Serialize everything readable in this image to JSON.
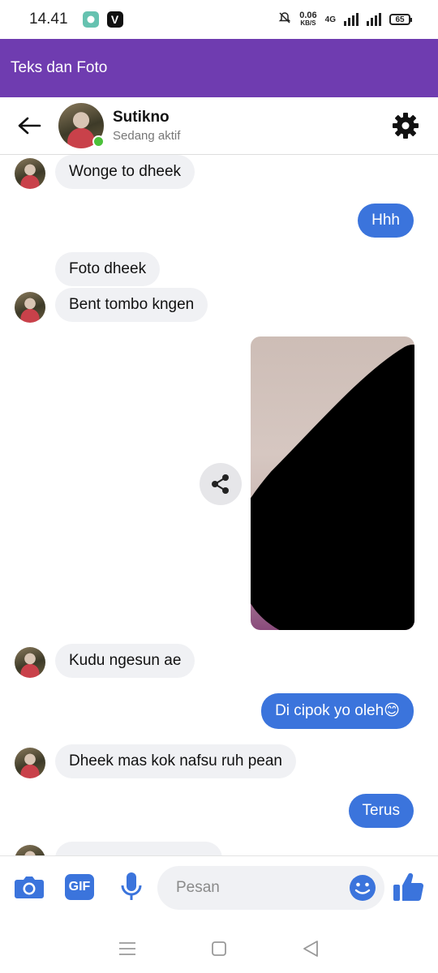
{
  "status_bar": {
    "time": "14.41",
    "net_speed": "0.06",
    "net_unit": "KB/S",
    "network": "4G",
    "battery": "65"
  },
  "app_bar": {
    "title": "Teks dan Foto"
  },
  "chat_header": {
    "name": "Sutikno",
    "status": "Sedang aktif"
  },
  "messages": [
    {
      "side": "in",
      "text": "Wonge to dheek"
    },
    {
      "side": "out",
      "text": "Hhh"
    },
    {
      "side": "in",
      "text": "Foto dheek"
    },
    {
      "side": "in",
      "text": "Bent tombo kngen"
    },
    {
      "side": "in",
      "text": "Kudu ngesun ae"
    },
    {
      "side": "out",
      "text": "Di cipok yo oleh😊"
    },
    {
      "side": "in",
      "text": "Dheek mas kok nafsu ruh pean"
    },
    {
      "side": "out",
      "text": "Terus"
    }
  ],
  "composer": {
    "placeholder": "Pesan",
    "gif_label": "GIF"
  },
  "colors": {
    "app_bar": "#6f3cb0",
    "accent_blue": "#3b74dc",
    "incoming_bubble": "#f0f1f4",
    "online": "#4cc13b"
  }
}
